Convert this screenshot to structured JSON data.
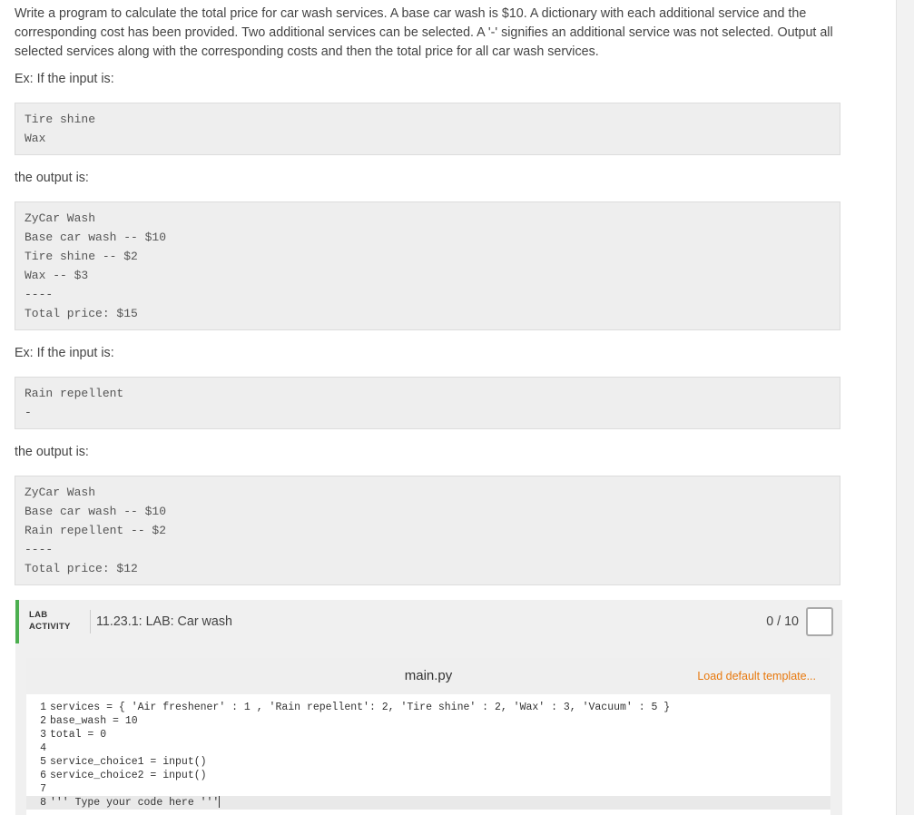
{
  "prompt": "Write a program to calculate the total price for car wash services. A base car wash is $10. A dictionary with each additional service and the corresponding cost has been provided. Two additional services can be selected. A '-' signifies an additional service was not selected. Output all selected services along with the corresponding costs and then the total price for all car wash services.",
  "example1": {
    "input_label": "Ex: If the input is:",
    "input_lines": [
      "Tire shine",
      "Wax"
    ],
    "output_label": "the output is:",
    "output_lines": [
      "ZyCar Wash",
      "Base car wash -- $10",
      "Tire shine -- $2",
      "Wax -- $3",
      "----",
      "Total price: $15"
    ]
  },
  "example2": {
    "input_label": "Ex: If the input is:",
    "input_lines": [
      "Rain repellent",
      "-"
    ],
    "output_label": "the output is:",
    "output_lines": [
      "ZyCar Wash",
      "Base car wash -- $10",
      "Rain repellent -- $2",
      "----",
      "Total price: $12"
    ]
  },
  "lab": {
    "tag_line1": "LAB",
    "tag_line2": "ACTIVITY",
    "title": "11.23.1: LAB: Car wash",
    "score": "0 / 10",
    "accent_color": "#4caf50"
  },
  "editor": {
    "file_name": "main.py",
    "load_template": "Load default template...",
    "lines": [
      {
        "n": "1",
        "text": "services = { 'Air freshener' : 1 , 'Rain repellent': 2, 'Tire shine' : 2, 'Wax' : 3, 'Vacuum' : 5 }"
      },
      {
        "n": "2",
        "text": "base_wash = 10"
      },
      {
        "n": "3",
        "text": "total = 0"
      },
      {
        "n": "4",
        "text": ""
      },
      {
        "n": "5",
        "text": "service_choice1 = input()"
      },
      {
        "n": "6",
        "text": "service_choice2 = input()"
      },
      {
        "n": "7",
        "text": ""
      },
      {
        "n": "8",
        "text": "''' Type your code here '''"
      }
    ]
  }
}
